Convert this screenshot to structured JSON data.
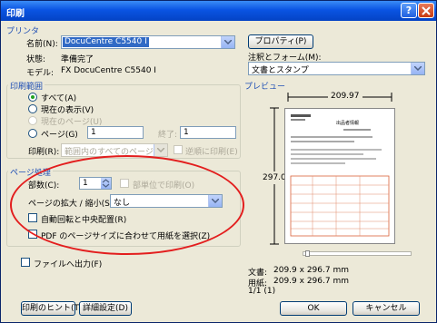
{
  "window": {
    "title": "印刷"
  },
  "printer_group": {
    "title": "プリンタ",
    "name_label": "名前(N):",
    "name_value": "DocuCentre C5540 I",
    "properties_button": "プロパティ(P)",
    "status_label": "状態:",
    "status_value": "準備完了",
    "model_label": "モデル:",
    "model_value": "FX DocuCentre C5540 I",
    "comments_forms_label": "注釈とフォーム(M):",
    "comments_forms_value": "文書とスタンプ"
  },
  "print_range": {
    "title": "印刷範囲",
    "all": "すべて(A)",
    "current_view": "現在の表示(V)",
    "current_page": "現在のページ(U)",
    "pages": "ページ(G)",
    "pages_from": "1",
    "to_label": "終了:",
    "pages_to": "1",
    "subset_label": "印刷(R):",
    "subset_value": "範囲内のすべてのページ",
    "reverse_label": "逆順に印刷(E)"
  },
  "page_handling": {
    "title": "ページ処理",
    "copies_label": "部数(C):",
    "copies_value": "1",
    "collate_label": "部単位で印刷(O)",
    "scaling_label": "ページの拡大 / 縮小(S):",
    "scaling_value": "なし",
    "autorotate_label": "自動回転と中央配置(R)",
    "choose_paper_label": "PDF のページサイズに合わせて用紙を選択(Z)"
  },
  "print_to_file_label": "ファイルへ出力(F)",
  "preview": {
    "title": "プレビュー",
    "width_label": "209.97",
    "height_label": "297.01",
    "doc_label": "文書:",
    "doc_size": "209.9 x 296.7 mm",
    "paper_label": "用紙:",
    "paper_size": "209.9 x 296.7 mm",
    "page_counter": "1/1 (1)",
    "thumb_title": "出品者情報"
  },
  "buttons": {
    "tips": "印刷のヒント(T)",
    "advanced": "詳細設定(D)",
    "ok": "OK",
    "cancel": "キャンセル"
  },
  "colors": {
    "title_bar": "#0a54e3",
    "dialog_bg": "#ece9d8",
    "group_title": "#1f4fb5",
    "annotation_oval": "#e31e1e",
    "selection": "#316ac5"
  }
}
